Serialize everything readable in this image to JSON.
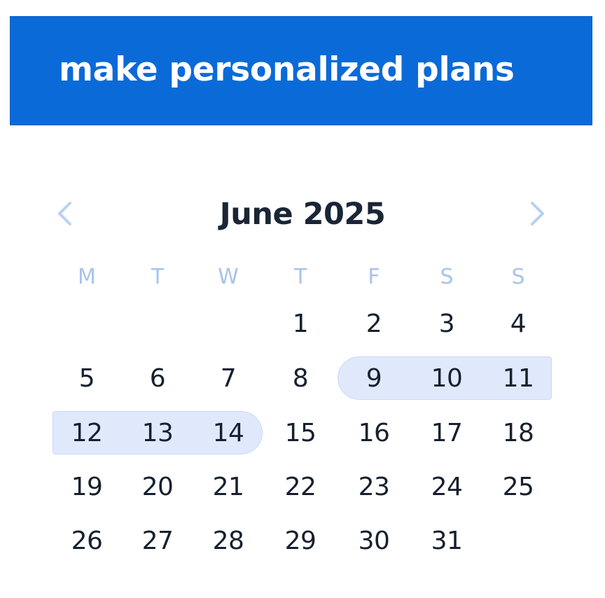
{
  "banner": {
    "title": "make personalized plans"
  },
  "calendar": {
    "month_title": "June 2025",
    "prev_icon": "chevron-left-icon",
    "next_icon": "chevron-right-icon",
    "weekdays": [
      "M",
      "T",
      "W",
      "T",
      "F",
      "S",
      "S"
    ],
    "weeks": [
      [
        "",
        "",
        "",
        "1",
        "2",
        "3",
        "4"
      ],
      [
        "5",
        "6",
        "7",
        "8",
        "9",
        "10",
        "11"
      ],
      [
        "12",
        "13",
        "14",
        "15",
        "16",
        "17",
        "18"
      ],
      [
        "19",
        "20",
        "21",
        "22",
        "23",
        "24",
        "25"
      ],
      [
        "26",
        "27",
        "28",
        "29",
        "30",
        "31",
        ""
      ]
    ],
    "selected_ranges": [
      [
        "9",
        "10",
        "11"
      ],
      [
        "12",
        "13",
        "14"
      ]
    ]
  },
  "colors": {
    "banner_background": "#0a6ad8",
    "banner_text": "#ffffff",
    "title_text": "#1a2535",
    "weekday_text": "#a9c3ec",
    "day_text": "#16202e",
    "chevron": "#b9d0f2",
    "range_highlight": "#dfe9fb"
  }
}
